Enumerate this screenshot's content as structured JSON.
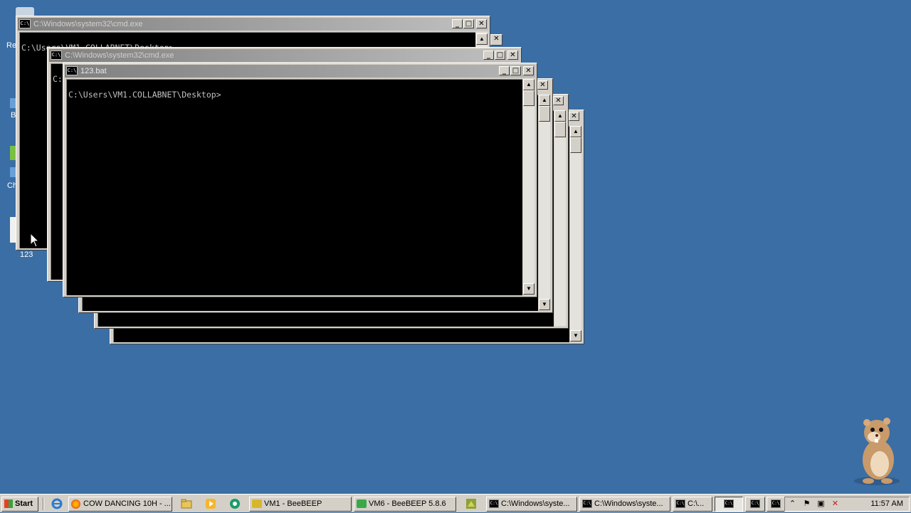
{
  "desktop": {
    "icon_labels": [
      "Re",
      "B",
      "Ch",
      "123"
    ]
  },
  "windows": [
    {
      "title": "C:\\Windows\\system32\\cmd.exe",
      "text": "C:\\Users\\VM1.COLLABNET\\Desktop>"
    },
    {
      "title": "C:\\Windows\\system32\\cmd.exe",
      "text": "C:"
    },
    {
      "title": "123.bat",
      "text": "C:\\Users\\VM1.COLLABNET\\Desktop>"
    }
  ],
  "window_controls": {
    "minimize": "_",
    "maximize": "□",
    "close": "✕"
  },
  "taskbar": {
    "start_label": "Start",
    "buttons": [
      {
        "label": "COW DANCING 10H - ...",
        "icon": "firefox-icon"
      },
      {
        "label": "VM1 - BeeBEEP",
        "icon": "beebeep-icon"
      },
      {
        "label": "VM6 - BeeBEEP 5.8.6",
        "icon": "vm-icon"
      },
      {
        "label": "C:\\Windows\\syste...",
        "icon": "cmd-icon"
      },
      {
        "label": "C:\\Windows\\syste...",
        "icon": "cmd-icon"
      },
      {
        "label": "C:\\...",
        "icon": "cmd-icon"
      }
    ],
    "clock": "11:57 AM"
  },
  "colors": {
    "desktop": "#3a6ea5",
    "window_face": "#d4d0c8",
    "console_bg": "#000000",
    "console_text": "#c0c0c0"
  }
}
